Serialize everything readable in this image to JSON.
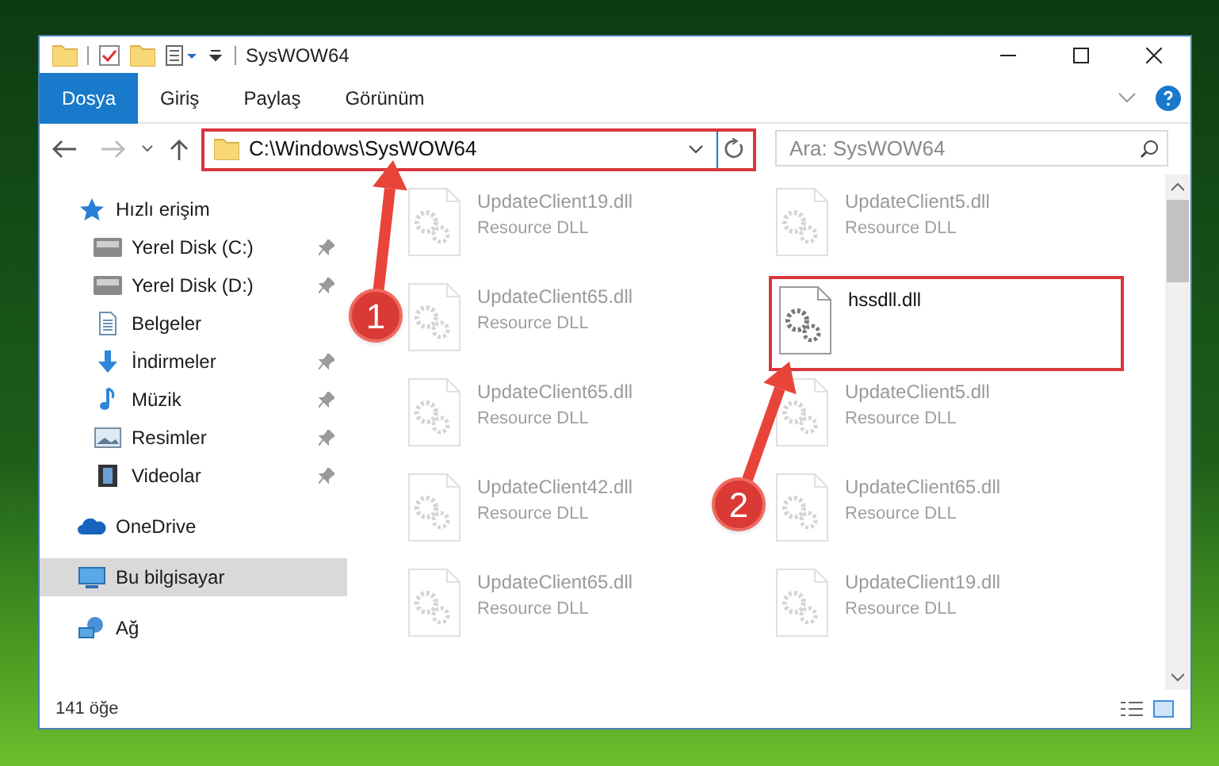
{
  "window": {
    "title": "SysWOW64"
  },
  "ribbon_tabs": [
    {
      "label": "Dosya",
      "selected": true
    },
    {
      "label": "Giriş",
      "selected": false
    },
    {
      "label": "Paylaş",
      "selected": false
    },
    {
      "label": "Görünüm",
      "selected": false
    }
  ],
  "address": {
    "value": "C:\\Windows\\SysWOW64",
    "highlighted": true
  },
  "search": {
    "placeholder": "Ara: SysWOW64"
  },
  "nav": [
    {
      "label": "Hızlı erişim",
      "kind": "star",
      "selected": false,
      "children": [
        {
          "label": "Yerel Disk (C:)",
          "kind": "drive",
          "pinned": true
        },
        {
          "label": "Yerel Disk (D:)",
          "kind": "drive",
          "pinned": true
        },
        {
          "label": "Belgeler",
          "kind": "document",
          "pinned": false
        },
        {
          "label": "İndirmeler",
          "kind": "download",
          "pinned": true
        },
        {
          "label": "Müzik",
          "kind": "music",
          "pinned": true
        },
        {
          "label": "Resimler",
          "kind": "picture",
          "pinned": true
        },
        {
          "label": "Videolar",
          "kind": "video",
          "pinned": true
        }
      ]
    },
    {
      "label": "OneDrive",
      "kind": "cloud",
      "selected": false
    },
    {
      "label": "Bu bilgisayar",
      "kind": "computer",
      "selected": true
    },
    {
      "label": "Ağ",
      "kind": "network",
      "selected": false
    }
  ],
  "files": [
    {
      "name": "UpdateClient19.dll",
      "type": "Resource DLL",
      "faded": true,
      "highlighted": false
    },
    {
      "name": "UpdateClient5.dll",
      "type": "Resource DLL",
      "faded": true,
      "highlighted": false
    },
    {
      "name": "UpdateClient65.dll",
      "type": "Resource DLL",
      "faded": true,
      "highlighted": false
    },
    {
      "name": "hssdll.dll",
      "faded": false,
      "highlighted": true
    },
    {
      "name": "UpdateClient65.dll",
      "type": "Resource DLL",
      "faded": true,
      "highlighted": false
    },
    {
      "name": "UpdateClient5.dll",
      "type": "Resource DLL",
      "faded": true,
      "highlighted": false
    },
    {
      "name": "UpdateClient42.dll",
      "type": "Resource DLL",
      "faded": true,
      "highlighted": false
    },
    {
      "name": "UpdateClient65.dll",
      "type": "Resource DLL",
      "faded": true,
      "highlighted": false
    },
    {
      "name": "UpdateClient65.dll",
      "type": "Resource DLL",
      "faded": true,
      "highlighted": false
    },
    {
      "name": "UpdateClient19.dll",
      "type": "Resource DLL",
      "faded": true,
      "highlighted": false
    }
  ],
  "annotations": [
    {
      "label": "1"
    },
    {
      "label": "2"
    }
  ],
  "status_bar": {
    "count": "141 öğe"
  }
}
